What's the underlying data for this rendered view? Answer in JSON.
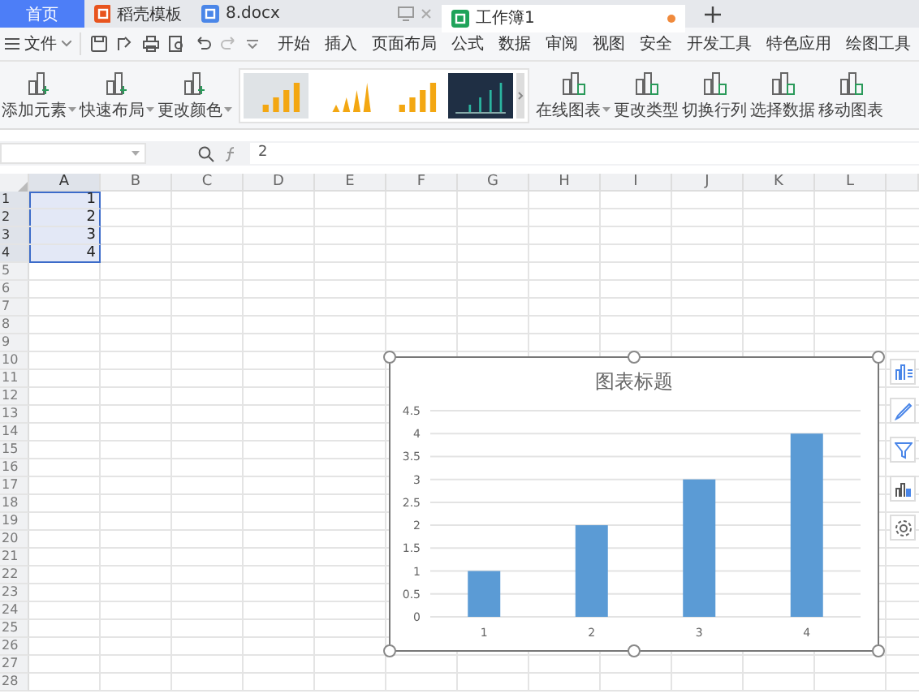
{
  "tabs": [
    {
      "label": "首页",
      "kind": "home",
      "selected": false,
      "modified": false
    },
    {
      "label": "稻壳模板",
      "kind": "docer",
      "selected": false,
      "modified": false
    },
    {
      "label": "8.docx",
      "kind": "writer",
      "selected": false,
      "modified": false
    },
    {
      "label": "工作簿1",
      "kind": "sheet",
      "selected": true,
      "modified": true
    }
  ],
  "menu": {
    "file_label": "文件",
    "items": [
      "开始",
      "插入",
      "页面布局",
      "公式",
      "数据",
      "审阅",
      "视图",
      "安全",
      "开发工具",
      "特色应用",
      "绘图工具"
    ]
  },
  "ribbon": {
    "tools_left": [
      {
        "label": "添加元素",
        "dropdown": true
      },
      {
        "label": "快速布局",
        "dropdown": true
      },
      {
        "label": "更改颜色",
        "dropdown": true
      }
    ],
    "styles": [
      {
        "kind": "shaded"
      },
      {
        "kind": "cone"
      },
      {
        "kind": "plain"
      },
      {
        "kind": "dark"
      }
    ],
    "tools_right": [
      {
        "label": "在线图表",
        "dropdown": true
      },
      {
        "label": "更改类型",
        "dropdown": false
      },
      {
        "label": "切换行列",
        "dropdown": false
      },
      {
        "label": "选择数据",
        "dropdown": false
      },
      {
        "label": "移动图表",
        "dropdown": false
      }
    ]
  },
  "formula_bar": {
    "value": "2"
  },
  "sheet": {
    "columns": [
      {
        "label": "A",
        "selected": true
      },
      {
        "label": "B",
        "selected": false
      },
      {
        "label": "C",
        "selected": false
      },
      {
        "label": "D",
        "selected": false
      },
      {
        "label": "E",
        "selected": false
      },
      {
        "label": "F",
        "selected": false
      },
      {
        "label": "G",
        "selected": false
      },
      {
        "label": "H",
        "selected": false
      },
      {
        "label": "I",
        "selected": false
      },
      {
        "label": "J",
        "selected": false
      },
      {
        "label": "K",
        "selected": false
      },
      {
        "label": "L",
        "selected": false
      }
    ],
    "rows": [
      {
        "header": "1",
        "values": [
          "1"
        ],
        "selected": true
      },
      {
        "header": "2",
        "values": [
          "2"
        ],
        "selected": true
      },
      {
        "header": "3",
        "values": [
          "3"
        ],
        "selected": true
      },
      {
        "header": "4",
        "values": [
          "4"
        ],
        "selected": true
      },
      {
        "header": "5",
        "selected": false
      },
      {
        "header": "6",
        "selected": false
      },
      {
        "header": "7",
        "selected": false
      },
      {
        "header": "8",
        "selected": false
      },
      {
        "header": "9",
        "selected": false
      },
      {
        "header": "10",
        "selected": false
      },
      {
        "header": "11",
        "selected": false
      },
      {
        "header": "12",
        "selected": false
      },
      {
        "header": "13",
        "selected": false
      },
      {
        "header": "14",
        "selected": false
      },
      {
        "header": "15",
        "selected": false
      },
      {
        "header": "16",
        "selected": false
      },
      {
        "header": "17",
        "selected": false
      },
      {
        "header": "18",
        "selected": false
      },
      {
        "header": "19",
        "selected": false
      },
      {
        "header": "20",
        "selected": false
      },
      {
        "header": "21",
        "selected": false
      },
      {
        "header": "22",
        "selected": false
      },
      {
        "header": "23",
        "selected": false
      },
      {
        "header": "24",
        "selected": false
      },
      {
        "header": "25",
        "selected": false
      },
      {
        "header": "26",
        "selected": false
      },
      {
        "header": "27",
        "selected": false
      },
      {
        "header": "28",
        "selected": false
      }
    ]
  },
  "chart": {
    "chart_data": {
      "type": "bar",
      "grid": true,
      "title": "图表标题",
      "categories": [
        "1",
        "2",
        "3",
        "4"
      ],
      "values": [
        1,
        2,
        3,
        4
      ],
      "ylim": [
        0,
        4.5
      ],
      "yticks": [
        0,
        0.5,
        1,
        1.5,
        2,
        2.5,
        3,
        3.5,
        4,
        4.5
      ]
    }
  }
}
